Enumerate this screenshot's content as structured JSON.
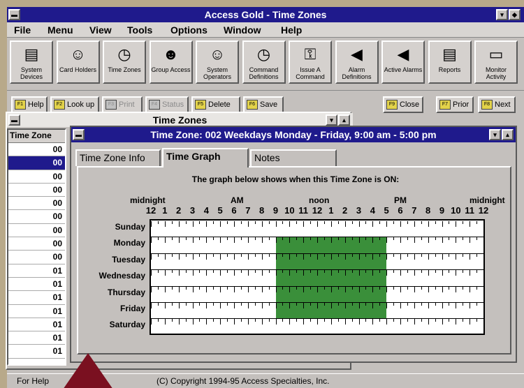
{
  "app": {
    "title": "Access Gold - Time Zones",
    "sys_minimize": "▾",
    "sys_restore": "◆"
  },
  "menu": [
    "File",
    "Menu",
    "View",
    "Tools",
    "Options",
    "Window",
    "Help"
  ],
  "toolbar": [
    {
      "label": "System Devices",
      "icon": "system-devices-icon",
      "glyph": "▤"
    },
    {
      "label": "Card Holders",
      "icon": "card-holders-icon",
      "glyph": "☺"
    },
    {
      "label": "Time Zones",
      "icon": "time-zones-icon",
      "glyph": "◷"
    },
    {
      "label": "Group Access",
      "icon": "group-access-icon",
      "glyph": "☻"
    },
    {
      "label": "System Operators",
      "icon": "system-operators-icon",
      "glyph": "☺"
    },
    {
      "label": "Command Definitions",
      "icon": "command-definitions-icon",
      "glyph": "◷"
    },
    {
      "label": "Issue A Command",
      "icon": "issue-command-icon",
      "glyph": "⚿"
    },
    {
      "label": "Alarm Definitions",
      "icon": "alarm-definitions-icon",
      "glyph": "◀"
    },
    {
      "label": "Active Alarms",
      "icon": "active-alarms-icon",
      "glyph": "◀"
    },
    {
      "label": "Reports",
      "icon": "reports-icon",
      "glyph": "▤"
    },
    {
      "label": "Monitor Activity",
      "icon": "monitor-activity-icon",
      "glyph": "▭"
    }
  ],
  "buttons": {
    "help": "Help",
    "lookup": "Look up",
    "print": "Print",
    "status": "Status",
    "delete": "Delete",
    "save": "Save",
    "close": "Close",
    "prior": "Prior",
    "next": "Next"
  },
  "list_window": {
    "title": "Time Zones",
    "column_header": "Time Zone",
    "rows": [
      "00",
      "00",
      "00",
      "00",
      "00",
      "00",
      "00",
      "00",
      "00",
      "01",
      "01",
      "01",
      "01",
      "01",
      "01",
      "01"
    ],
    "selected_index": 1
  },
  "detail": {
    "title": "Time Zone: 002 Weekdays Monday - Friday, 9:00 am - 5:00 pm",
    "tabs": [
      "Time Zone Info",
      "Time Graph",
      "Notes"
    ],
    "active_tab": "Time Graph",
    "caption": "The graph below shows when this Time Zone is ON:",
    "header_labels": {
      "midnight_left": "midnight",
      "am": "AM",
      "noon": "noon",
      "pm": "PM",
      "midnight_right": "midnight"
    },
    "hours": [
      "12",
      "1",
      "2",
      "3",
      "4",
      "5",
      "6",
      "7",
      "8",
      "9",
      "10",
      "11",
      "12",
      "1",
      "2",
      "3",
      "4",
      "5",
      "6",
      "7",
      "8",
      "9",
      "10",
      "11",
      "12"
    ],
    "days": [
      "Sunday",
      "Monday",
      "Tuesday",
      "Wednesday",
      "Thursday",
      "Friday",
      "Saturday"
    ],
    "on_days": [
      "Monday",
      "Tuesday",
      "Wednesday",
      "Thursday",
      "Friday"
    ],
    "on_start_hour": 9,
    "on_end_hour": 17,
    "on_color": "#3a8f3a"
  },
  "status_bar": {
    "left": "For Help",
    "center": "(C) Copyright 1994-95 Access Specialties, Inc."
  }
}
